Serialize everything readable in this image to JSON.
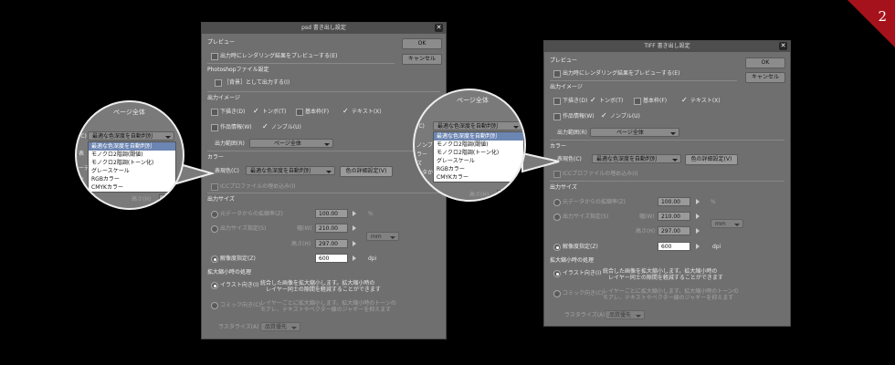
{
  "badge": "2",
  "psd": {
    "title": "psd 書き出し設定",
    "preview_h": "プレビュー",
    "preview_cb": "出力時にレンダリング結果をプレビューする(E)",
    "ps_h": "Photoshopファイル設定",
    "bg_cb": "［背景］として出力する(I)",
    "img_h": "出力イメージ",
    "draft": "下描き(D)",
    "tonbo": "トンボ(T)",
    "kihon": "基本枠(F)",
    "text": "テキスト(X)",
    "work": "作品情報(W)",
    "nombre": "ノンブル(U)",
    "range_label": "出力範囲(R)",
    "range_value": "ページ全体",
    "color_h": "カラー",
    "expr_label": "表現色(C)",
    "expr_value": "最適な色深度を自動判別",
    "color_btn": "色の詳細設定(V)",
    "icc": "ICCプロファイルの埋め込み(I)",
    "size_h": "出力サイズ",
    "scale_label": "元データからの拡縮率(Z)",
    "scale_value": "100.00",
    "pct": "%",
    "outsize_label": "出力サイズ指定(S)",
    "w_label": "幅(W)",
    "w_value": "210.00",
    "h_label": "高さ(H)",
    "h_value": "297.00",
    "unit": "mm",
    "res_label": "解像度指定(Z)",
    "res_value": "600",
    "dpi": "dpi",
    "scaleproc_h": "拡大縮小時の処理",
    "illust": "イラスト向き(I)",
    "illust_d1": "統合した画像を拡大縮小します。拡大縮小時の",
    "illust_d2": "レイヤー同士の隙間を軽減することができます",
    "comic": "コミック向き(C)",
    "comic_d1": "レイヤーごとに拡大縮小します。拡大縮小時のトーンの",
    "comic_d2": "モアレ、テキストやベクター線のジャギーを抑えます",
    "raster_label": "ラスタライズ(A)",
    "raster_value": "品質優先",
    "ok": "OK",
    "cancel": "キャンセル"
  },
  "tiff": {
    "title": "TIFF 書き出し設定",
    "preview_h": "プレビュー",
    "preview_cb": "出力時にレンダリング結果をプレビューする(E)",
    "img_h": "出力イメージ",
    "draft": "下描き(D)",
    "tonbo": "トンボ(T)",
    "kihon": "基本枠(F)",
    "text": "テキスト(X)",
    "work": "作品情報(W)",
    "nombre": "ノンブル(U)",
    "range_label": "出力範囲(R)",
    "range_value": "ページ全体",
    "color_h": "カラー",
    "expr_label": "表現色(C)",
    "expr_value": "最適な色深度を自動判別",
    "color_btn": "色の詳細設定(V)",
    "icc": "ICCプロファイルの埋め込み(I)",
    "size_h": "出力サイズ",
    "scale_label": "元データからの拡縮率(Z)",
    "scale_value": "100.00",
    "pct": "%",
    "outsize_label": "出力サイズ指定(S)",
    "w_label": "幅(W)",
    "w_value": "210.00",
    "h_label": "高さ(H)",
    "h_value": "297.00",
    "unit": "mm",
    "res_label": "解像度指定(Z)",
    "res_value": "600",
    "dpi": "dpi",
    "scaleproc_h": "拡大縮小時の処理",
    "illust": "イラスト向き(I)",
    "illust_d1": "統合した画像を拡大縮小します。拡大縮小時の",
    "illust_d2": "レイヤー同士の隙間を軽減することができます",
    "comic": "コミック向き(C)",
    "comic_d1": "レイヤーごとに拡大縮小します。拡大縮小時のトーンの",
    "comic_d2": "モアレ、テキストやベクター線のジャギーを抑えます",
    "raster_label": "ラスタライズ(A)",
    "raster_value": "品質優先",
    "ok": "OK",
    "cancel": "キャンセル"
  },
  "mag1": {
    "title": "ページ全体",
    "frag_c": "(C)",
    "frag_hyou": "表",
    "frag_re": "ーデ",
    "frag_ize": "ズ",
    "frag_o": "イ",
    "frag_h": "高さ(H)",
    "frag_v": "297"
  },
  "mag2": {
    "title": "ページ全体",
    "frag_c": "(C)",
    "frag_fu": "ノンブ",
    "frag_ra": "ラー",
    "frag_ize": "ズ",
    "frag_de": "ータか",
    "frag_shi": "サイ",
    "frag_h": "高さ(H)",
    "frag_v": "297.0"
  },
  "color_options": [
    "最適な色深度を自動判別",
    "モノクロ2階調(閾値)",
    "モノクロ2階調(トーン化)",
    "グレースケール",
    "RGBカラー",
    "CMYKカラー"
  ]
}
